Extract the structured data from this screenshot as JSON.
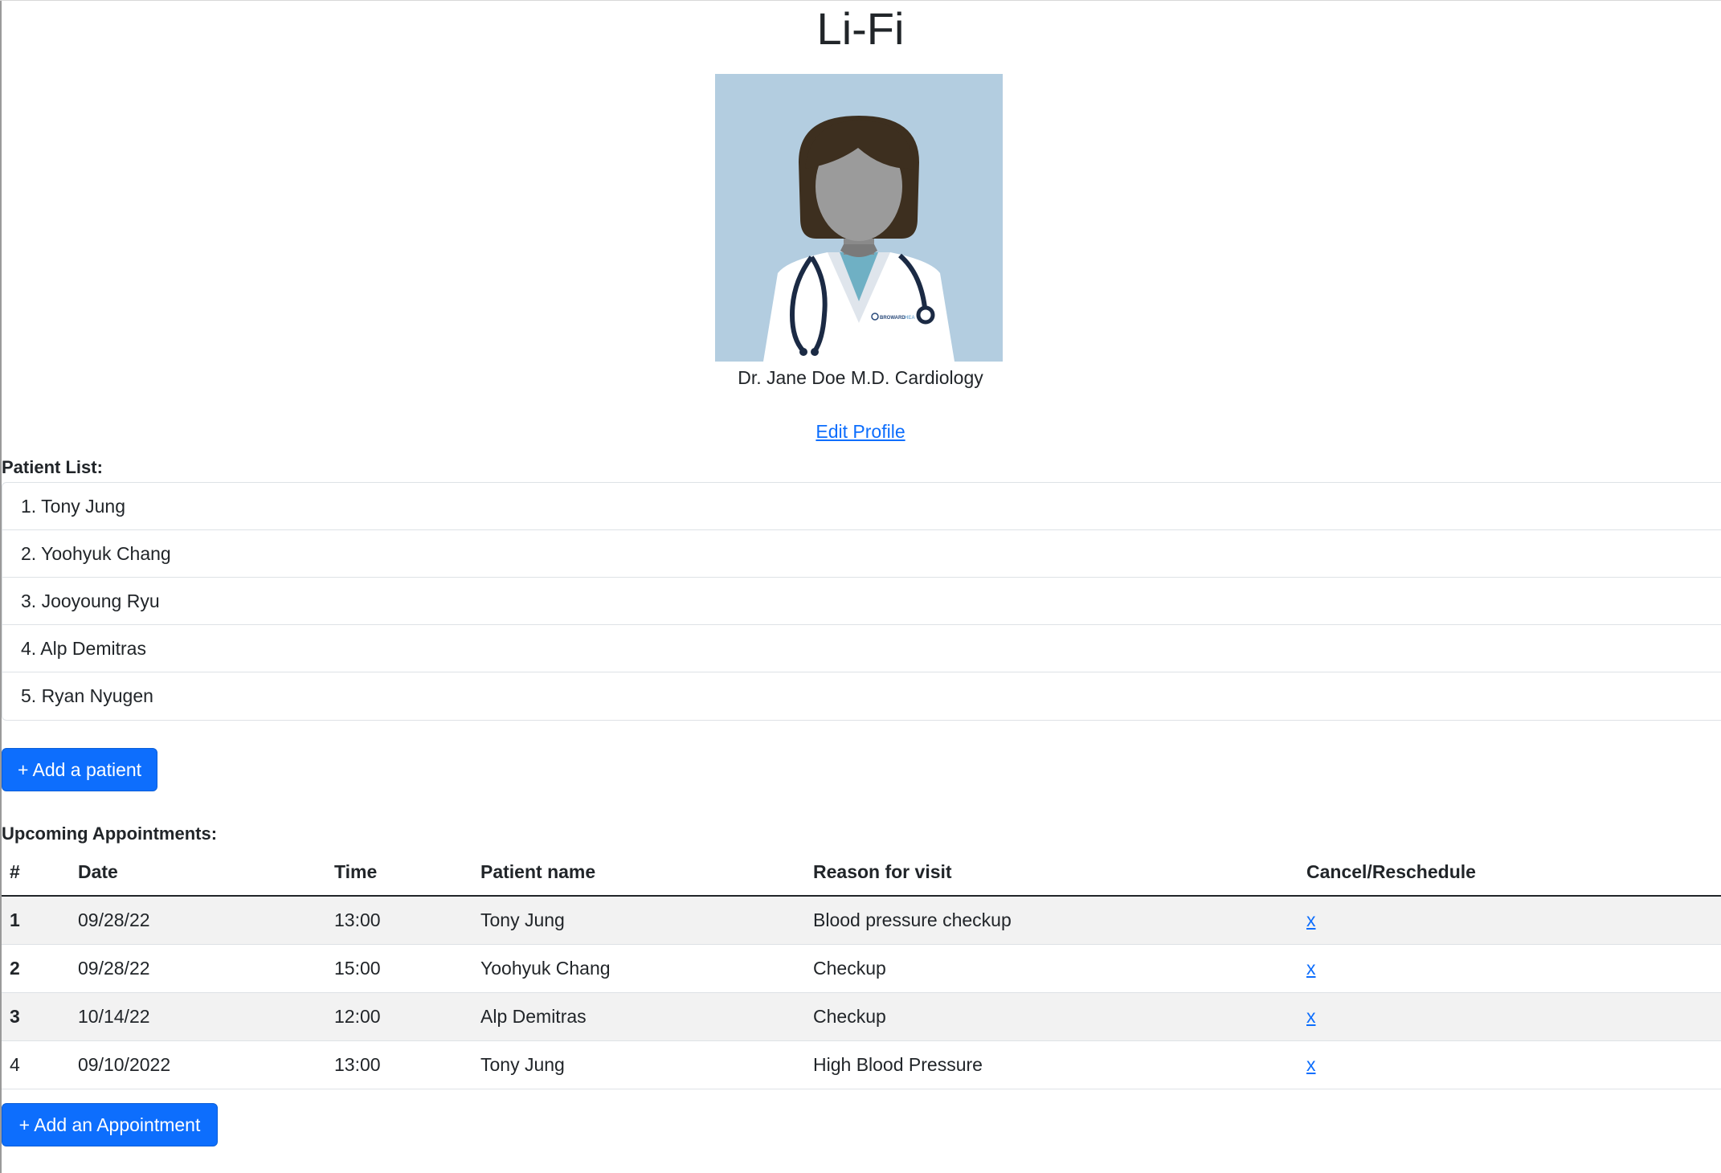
{
  "app": {
    "title": "Li-Fi"
  },
  "profile": {
    "doctor_name": "Dr. Jane Doe M.D. Cardiology",
    "edit_link": "Edit Profile",
    "avatar_badge": "BROWARD HEALTH",
    "avatar_bg": "#b3cde0"
  },
  "patients": {
    "label": "Patient List:",
    "items": [
      "1. Tony Jung",
      "2. Yoohyuk Chang",
      "3. Jooyoung Ryu",
      "4. Alp Demitras",
      "5. Ryan Nyugen"
    ],
    "add_button": "+ Add a patient"
  },
  "appointments": {
    "label": "Upcoming Appointments:",
    "headers": [
      "#",
      "Date",
      "Time",
      "Patient name",
      "Reason for visit",
      "Cancel/Reschedule"
    ],
    "rows": [
      {
        "num": "1",
        "date": "09/28/22",
        "time": "13:00",
        "patient": "Tony Jung",
        "reason": "Blood pressure checkup",
        "action": "x"
      },
      {
        "num": "2",
        "date": "09/28/22",
        "time": "15:00",
        "patient": "Yoohyuk Chang",
        "reason": "Checkup",
        "action": "x"
      },
      {
        "num": "3",
        "date": "10/14/22",
        "time": "12:00",
        "patient": "Alp Demitras",
        "reason": "Checkup",
        "action": "x"
      },
      {
        "num": "4",
        "date": "09/10/2022",
        "time": "13:00",
        "patient": "Tony Jung",
        "reason": "High Blood Pressure",
        "action": "x"
      }
    ],
    "add_button": "+ Add an Appointment"
  },
  "colors": {
    "primary": "#0d6efd",
    "stripe": "#f2f2f2",
    "text": "#212529"
  }
}
